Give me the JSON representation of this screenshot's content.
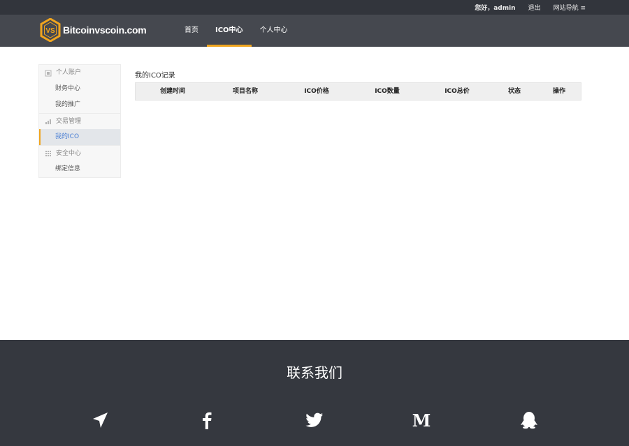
{
  "topbar": {
    "greeting": "您好，admin",
    "logout": "退出",
    "site_nav": "网站导航 ≡"
  },
  "header": {
    "logo_text": "Bitcoinvscoin.com",
    "logo_badge": "VS",
    "nav": [
      {
        "label": "首页",
        "active": false
      },
      {
        "label": "ICO中心",
        "active": true
      },
      {
        "label": "个人中心",
        "active": false
      }
    ],
    "accent_color": "#f0a51e"
  },
  "sidebar": {
    "groups": [
      {
        "label": "个人账户",
        "icon": "account-icon",
        "items": [
          {
            "label": "财务中心",
            "active": false
          },
          {
            "label": "我的推广",
            "active": false
          }
        ]
      },
      {
        "label": "交易管理",
        "icon": "chart-icon",
        "items": [
          {
            "label": "我的ICO",
            "active": true
          }
        ]
      },
      {
        "label": "安全中心",
        "icon": "grid-icon",
        "items": [
          {
            "label": "绑定信息",
            "active": false
          }
        ]
      }
    ]
  },
  "main": {
    "title": "我的ICO记录",
    "columns": [
      "创建时间",
      "项目名称",
      "ICO价格",
      "ICO数量",
      "ICO总价",
      "状态",
      "操作"
    ]
  },
  "footer": {
    "title": "联系我们",
    "social": [
      "telegram-icon",
      "facebook-icon",
      "twitter-icon",
      "medium-icon",
      "qq-icon"
    ]
  }
}
